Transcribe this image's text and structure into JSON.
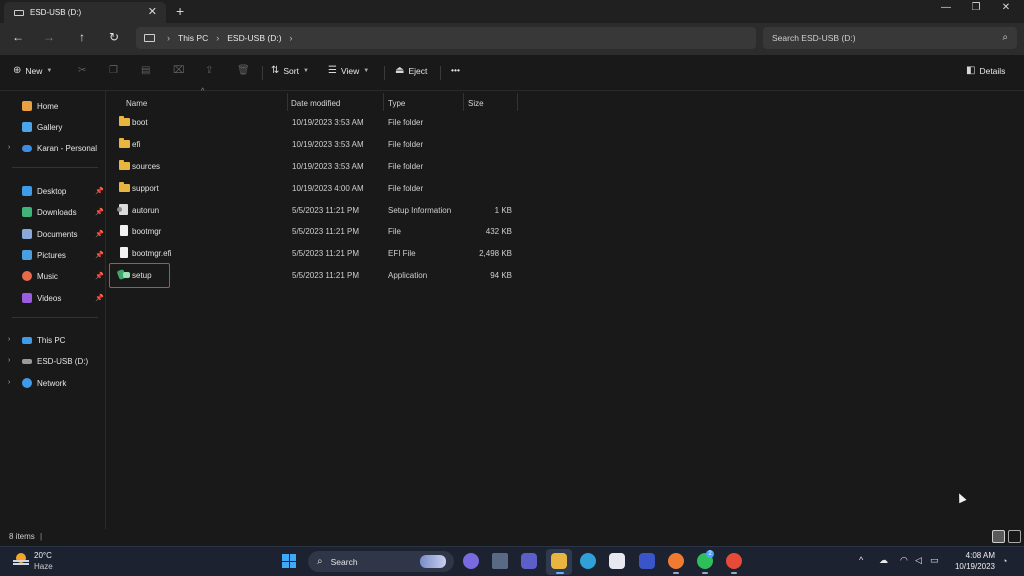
{
  "window": {
    "tab_title": "ESD-USB (D:)",
    "tab_close": "✕",
    "tab_add": "+",
    "minimize": "—",
    "maximize": "❐",
    "close": "✕"
  },
  "nav": {
    "back": "←",
    "forward": "→",
    "up": "↑",
    "refresh": "↻",
    "breadcrumb": [
      "This PC",
      "ESD-USB (D:)"
    ],
    "chevron": "›",
    "search_placeholder": "Search ESD-USB (D:)"
  },
  "commands": {
    "new_label": "New",
    "sort_label": "Sort",
    "view_label": "View",
    "eject_label": "Eject",
    "more_label": "•••",
    "details_label": "Details"
  },
  "sidebar": {
    "items": [
      {
        "label": "Home",
        "icon": "home-icon",
        "color": "#e8a040"
      },
      {
        "label": "Gallery",
        "icon": "gallery-icon",
        "color": "#4da3e8"
      },
      {
        "label": "Karan - Personal",
        "icon": "onedrive-icon",
        "color": "#3d8ee0"
      },
      {
        "label": "Desktop",
        "icon": "desktop-icon",
        "color": "#3f9ae8"
      },
      {
        "label": "Downloads",
        "icon": "downloads-icon",
        "color": "#3fb37a"
      },
      {
        "label": "Documents",
        "icon": "documents-icon",
        "color": "#8aa8d8"
      },
      {
        "label": "Pictures",
        "icon": "pictures-icon",
        "color": "#4a9fe0"
      },
      {
        "label": "Music",
        "icon": "music-icon",
        "color": "#e86a4a"
      },
      {
        "label": "Videos",
        "icon": "videos-icon",
        "color": "#9a5ce0"
      },
      {
        "label": "This PC",
        "icon": "this-pc-icon",
        "color": "#3f9ae8"
      },
      {
        "label": "ESD-USB (D:)",
        "icon": "usb-drive-icon",
        "color": "#9a9a9a"
      },
      {
        "label": "Network",
        "icon": "network-icon",
        "color": "#3f9ae8"
      }
    ]
  },
  "columns": {
    "name": "Name",
    "date": "Date modified",
    "type": "Type",
    "size": "Size"
  },
  "files": [
    {
      "name": "boot",
      "date": "10/19/2023 3:53 AM",
      "type": "File folder",
      "size": "",
      "kind": "folder"
    },
    {
      "name": "efi",
      "date": "10/19/2023 3:53 AM",
      "type": "File folder",
      "size": "",
      "kind": "folder"
    },
    {
      "name": "sources",
      "date": "10/19/2023 3:53 AM",
      "type": "File folder",
      "size": "",
      "kind": "folder"
    },
    {
      "name": "support",
      "date": "10/19/2023 4:00 AM",
      "type": "File folder",
      "size": "",
      "kind": "folder"
    },
    {
      "name": "autorun",
      "date": "5/5/2023 11:21 PM",
      "type": "Setup Information",
      "size": "1 KB",
      "kind": "inf"
    },
    {
      "name": "bootmgr",
      "date": "5/5/2023 11:21 PM",
      "type": "File",
      "size": "432 KB",
      "kind": "file"
    },
    {
      "name": "bootmgr.efi",
      "date": "5/5/2023 11:21 PM",
      "type": "EFI File",
      "size": "2,498 KB",
      "kind": "file"
    },
    {
      "name": "setup",
      "date": "5/5/2023 11:21 PM",
      "type": "Application",
      "size": "94 KB",
      "kind": "setup"
    }
  ],
  "status": {
    "items_count": "8 items",
    "separator": "|"
  },
  "taskbar": {
    "temperature": "20°C",
    "weather": "Haze",
    "search_label": "Search",
    "time": "4:08 AM",
    "date": "10/19/2023",
    "whatsapp_badge": "2",
    "accent": "#3fa9f5"
  }
}
